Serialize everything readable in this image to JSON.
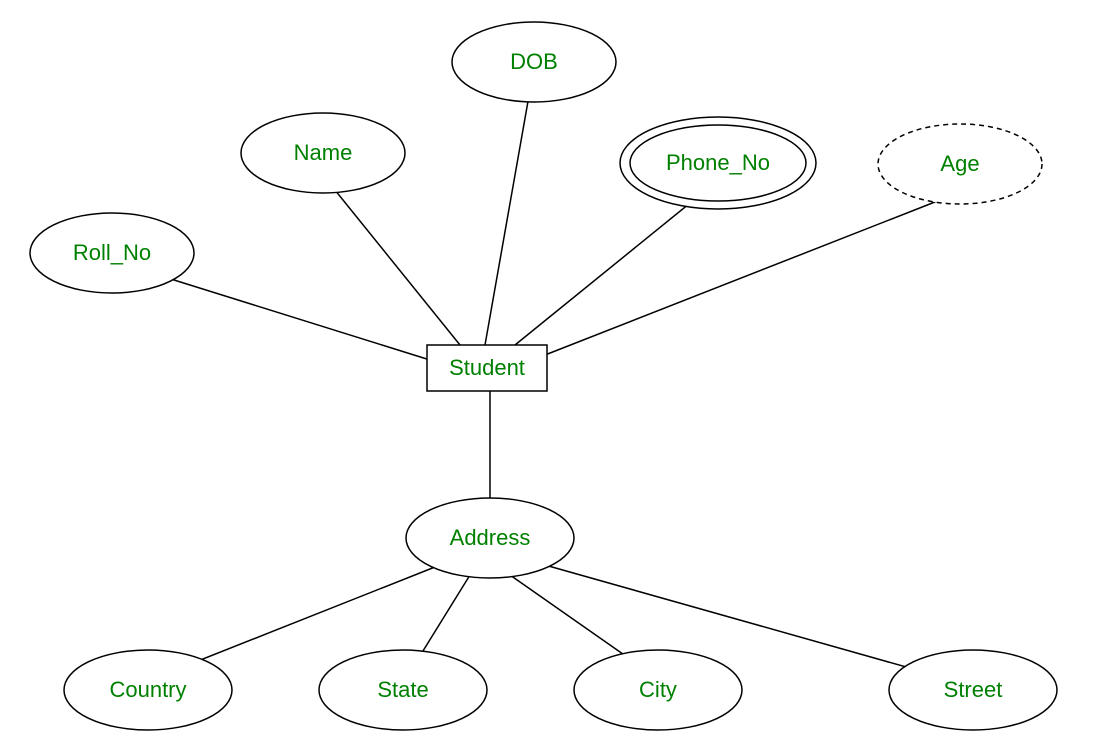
{
  "diagram": {
    "type": "er-diagram",
    "entity": {
      "label": "Student"
    },
    "attributes": {
      "roll_no": {
        "label": "Roll_No",
        "style": "simple"
      },
      "name": {
        "label": "Name",
        "style": "simple"
      },
      "dob": {
        "label": "DOB",
        "style": "simple"
      },
      "phone_no": {
        "label": "Phone_No",
        "style": "multivalued"
      },
      "age": {
        "label": "Age",
        "style": "derived"
      },
      "address": {
        "label": "Address",
        "style": "composite",
        "components": {
          "country": {
            "label": "Country"
          },
          "state": {
            "label": "State"
          },
          "city": {
            "label": "City"
          },
          "street": {
            "label": "Street"
          }
        }
      }
    }
  }
}
